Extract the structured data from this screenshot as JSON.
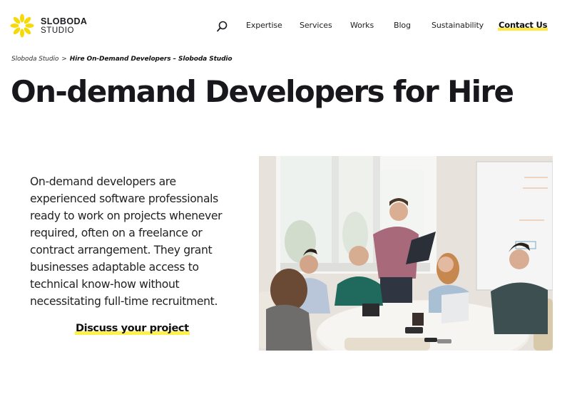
{
  "header": {
    "logo": {
      "line1": "SLOBODA",
      "line2": "STUDIO",
      "icon": "sunflower-petals-icon",
      "color": "#f5d90a"
    },
    "search_icon": "search-icon",
    "nav": [
      {
        "label": "Expertise"
      },
      {
        "label": "Services"
      },
      {
        "label": "Works"
      },
      {
        "label": "Blog"
      },
      {
        "label": "Sustainability"
      }
    ],
    "contact_label": "Contact Us",
    "highlight_color": "#ffe93a"
  },
  "breadcrumb": {
    "home": "Sloboda Studio",
    "separator": ">",
    "current": "Hire On-Demand Developers – Sloboda Studio"
  },
  "page": {
    "title": "On-demand Developers for Hire",
    "intro": "On-demand developers are experienced software professionals ready to work on projects whenever required, often on a freelance or contract arrangement. They grant businesses adaptable access to technical know-how without necessitating full-time recruitment.",
    "cta_label": "Discuss your project",
    "image_alt": "Team of developers meeting around a table in a bright office"
  }
}
